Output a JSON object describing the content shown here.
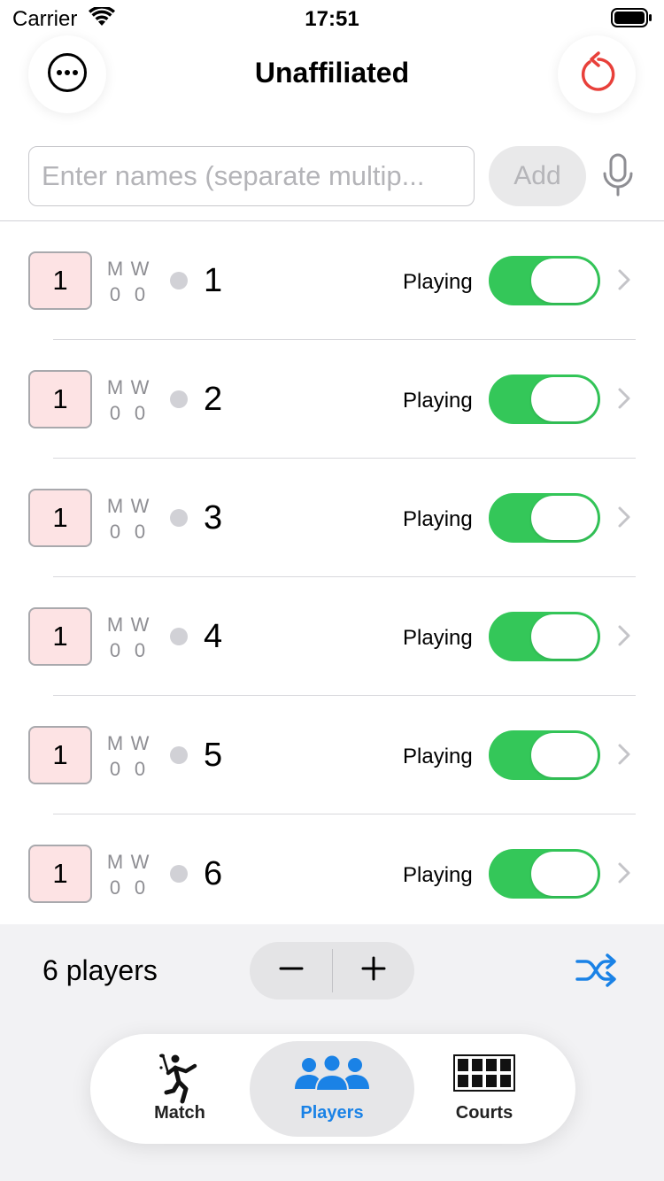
{
  "status_bar": {
    "carrier": "Carrier",
    "time": "17:51"
  },
  "nav": {
    "title": "Unaffiliated"
  },
  "input": {
    "placeholder": "Enter names (separate multip...",
    "value": "",
    "add_label": "Add"
  },
  "stats_labels": {
    "matches": "M",
    "wins": "W"
  },
  "players": [
    {
      "level": "1",
      "matches": "0",
      "wins": "0",
      "name": "1",
      "status": "Playing",
      "playing": true
    },
    {
      "level": "1",
      "matches": "0",
      "wins": "0",
      "name": "2",
      "status": "Playing",
      "playing": true
    },
    {
      "level": "1",
      "matches": "0",
      "wins": "0",
      "name": "3",
      "status": "Playing",
      "playing": true
    },
    {
      "level": "1",
      "matches": "0",
      "wins": "0",
      "name": "4",
      "status": "Playing",
      "playing": true
    },
    {
      "level": "1",
      "matches": "0",
      "wins": "0",
      "name": "5",
      "status": "Playing",
      "playing": true
    },
    {
      "level": "1",
      "matches": "0",
      "wins": "0",
      "name": "6",
      "status": "Playing",
      "playing": true
    }
  ],
  "footer": {
    "player_count": "6 players"
  },
  "tabs": [
    {
      "label": "Match",
      "icon": "badminton-player-icon"
    },
    {
      "label": "Players",
      "icon": "people-icon",
      "selected": true
    },
    {
      "label": "Courts",
      "icon": "courts-grid-icon"
    }
  ],
  "colors": {
    "accent": "#1a82e6",
    "toggle_on": "#34c759",
    "reset": "#e8403a",
    "level_bg": "#fde3e4",
    "dot": "#d1d1d6"
  }
}
